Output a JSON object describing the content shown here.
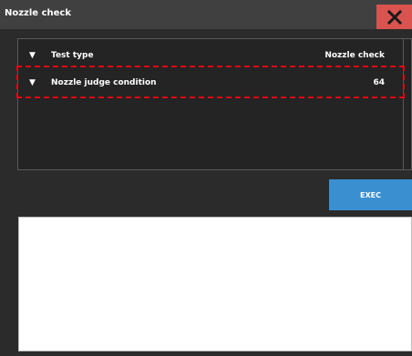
{
  "window": {
    "title": "Nozzle check",
    "close_icon": "close-icon"
  },
  "settings": {
    "rows": [
      {
        "label": "Test type",
        "value": "Nozzle check",
        "icon": "triangle-down-icon"
      },
      {
        "label": "Nozzle judge condition",
        "value": "64",
        "icon": "triangle-down-icon"
      }
    ]
  },
  "actions": {
    "exec_label": "EXEC"
  },
  "log": {
    "content": ""
  },
  "colors": {
    "titlebar": "#404040",
    "close": "#d9534f",
    "exec": "#3a8fd1",
    "highlight": "#e60012",
    "background": "#2b2b2b"
  }
}
